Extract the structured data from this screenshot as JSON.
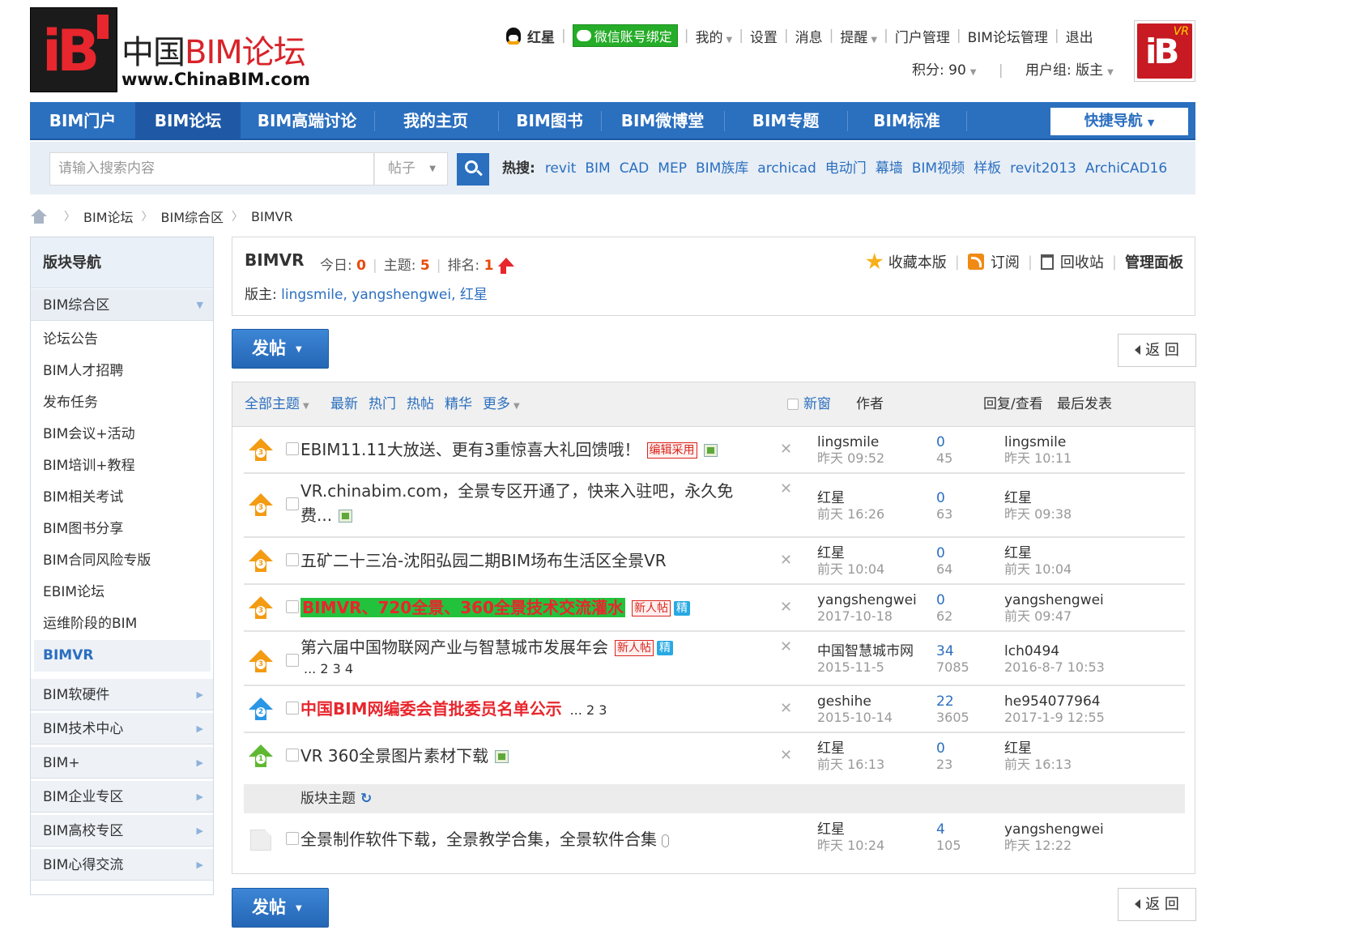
{
  "header": {
    "site_name_cn": "中国",
    "site_name_bim": "BIM论坛",
    "site_url": "www.ChinaBIM.com",
    "logo_text": "iB",
    "user": "红星",
    "wechat": "微信账号绑定",
    "links": [
      "我的",
      "设置",
      "消息",
      "提醒",
      "门户管理",
      "BIM论坛管理",
      "退出"
    ],
    "points": "积分: 90",
    "usergroup": "用户组: 版主",
    "avatar_text": "iB",
    "avatar_badge": "VR"
  },
  "nav": {
    "items": [
      "BIM门户",
      "BIM论坛",
      "BIM高端讨论",
      "我的主页",
      "BIM图书",
      "BIM微博堂",
      "BIM专题",
      "BIM标准"
    ],
    "active": "BIM论坛",
    "quicknav": "快捷导航"
  },
  "search": {
    "placeholder": "请输入搜索内容",
    "type": "帖子",
    "hot_label": "热搜:",
    "hot_keywords": [
      "revit",
      "BIM",
      "CAD",
      "MEP",
      "BIM族库",
      "archicad",
      "电动门",
      "幕墙",
      "BIM视频",
      "样板",
      "revit2013",
      "ArchiCAD16"
    ]
  },
  "breadcrumb": [
    "BIM论坛",
    "BIM综合区",
    "BIMVR"
  ],
  "sidebar": {
    "title": "版块导航",
    "group_open": "BIM综合区",
    "items": [
      "论坛公告",
      "BIM人才招聘",
      "发布任务",
      "BIM会议+活动",
      "BIM培训+教程",
      "BIM相关考试",
      "BIM图书分享",
      "BIM合同风险专版",
      "EBIM论坛",
      "运维阶段的BIM"
    ],
    "active": "BIMVR",
    "groups": [
      "BIM软硬件",
      "BIM技术中心",
      "BIM+",
      "BIM企业专区",
      "BIM高校专区",
      "BIM心得交流"
    ]
  },
  "forum": {
    "name": "BIMVR",
    "today_label": "今日:",
    "today": "0",
    "topics_label": "主题:",
    "topics": "5",
    "rank_label": "排名:",
    "rank": "1",
    "mods_label": "版主:",
    "mods": "lingsmile, yangshengwei, 红星",
    "actions": [
      "收藏本版",
      "订阅",
      "回收站",
      "管理面板"
    ]
  },
  "buttons": {
    "post": "发帖",
    "back": "返 回"
  },
  "list_header": {
    "filters": [
      "全部主题",
      "最新",
      "热门",
      "热帖",
      "精华",
      "更多"
    ],
    "newwin": "新窗",
    "author": "作者",
    "replies": "回复/查看",
    "last": "最后发表"
  },
  "threads": [
    {
      "level": "3",
      "title": "EBIM11.11大放送、更有3重惊喜大礼回馈哦！",
      "tag": "编辑采用",
      "author": "lingsmile",
      "date": "昨天 09:52",
      "replies": "0",
      "views": "45",
      "last_user": "lingsmile",
      "last_time": "昨天 10:11"
    },
    {
      "level": "3",
      "title": "VR.chinabim.com，全景专区开通了，快来入驻吧，永久免",
      "title2": "费...",
      "author": "红星",
      "date": "前天 16:26",
      "replies": "0",
      "views": "63",
      "last_user": "红星",
      "last_time": "昨天 09:38"
    },
    {
      "level": "3",
      "title": "五矿二十三冶-沈阳弘园二期BIM场布生活区全景VR",
      "author": "红星",
      "date": "前天 10:04",
      "replies": "0",
      "views": "64",
      "last_user": "红星",
      "last_time": "前天 10:04"
    },
    {
      "level": "3",
      "title": "BIMVR、720全景、360全景技术交流灌水",
      "tag": "新人帖",
      "tag2": "精",
      "author": "yangshengwei",
      "date": "2017-10-18",
      "replies": "0",
      "views": "62",
      "last_user": "yangshengwei",
      "last_time": "前天 09:47"
    },
    {
      "level": "3",
      "title": "第六届中国物联网产业与智慧城市发展年会",
      "tag": "新人帖",
      "tag2": "精",
      "pages": "... 2  3  4",
      "author": "中国智慧城市网",
      "date": "2015-11-5",
      "replies": "34",
      "views": "7085",
      "last_user": "lch0494",
      "last_time": "2016-8-7 10:53"
    },
    {
      "level": "2",
      "title": "中国BIM网编委会首批委员名单公示",
      "pages": "... 2  3",
      "author": "geshihe",
      "date": "2015-10-14",
      "replies": "22",
      "views": "3605",
      "last_user": "he954077964",
      "last_time": "2017-1-9 12:55"
    },
    {
      "level": "1",
      "title": "VR 360全景图片素材下载",
      "author": "红星",
      "date": "前天 16:13",
      "replies": "0",
      "views": "23",
      "last_user": "红星",
      "last_time": "前天 16:13"
    }
  ],
  "section_label": "版块主题",
  "normal_thread": {
    "title": "全景制作软件下载，全景教学合集，全景软件合集",
    "author": "红星",
    "date": "昨天 10:24",
    "replies": "4",
    "views": "105",
    "last_user": "yangshengwei",
    "last_time": "昨天 12:22"
  }
}
